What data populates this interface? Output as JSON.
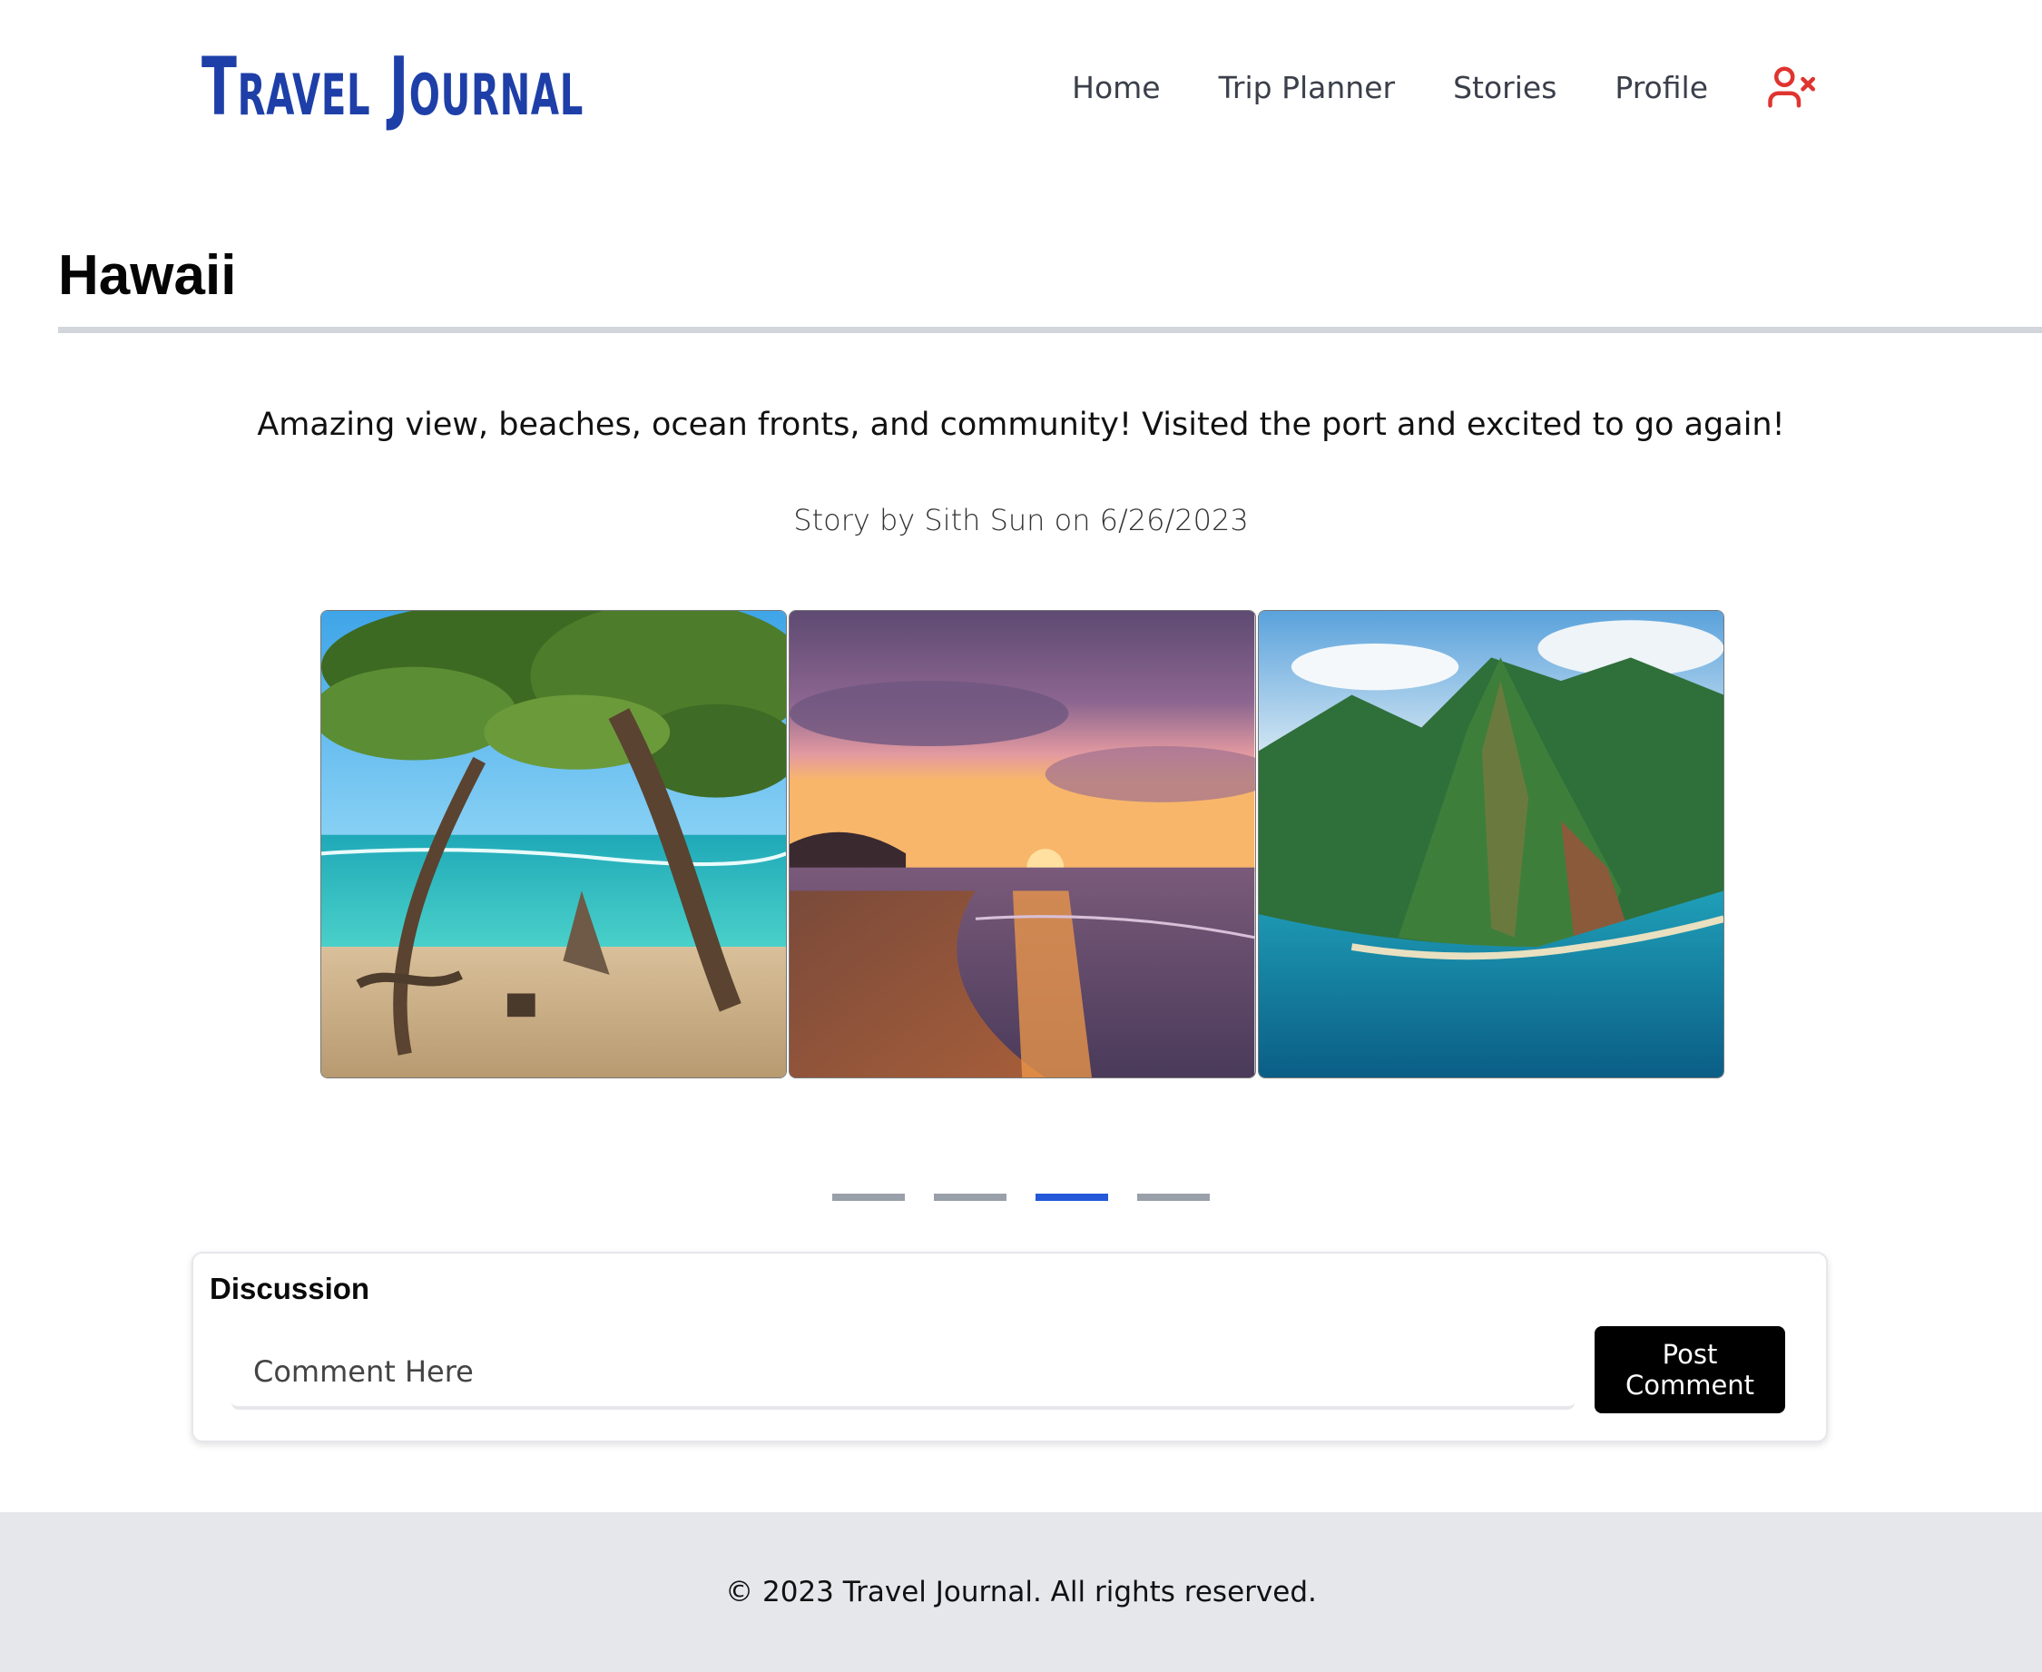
{
  "header": {
    "logo": "Travel Journal",
    "nav": [
      "Home",
      "Trip Planner",
      "Stories",
      "Profile"
    ],
    "logout_icon": "user-x-icon",
    "logout_icon_color": "#e0342f",
    "logo_color": "#1e3fa8"
  },
  "story": {
    "title": "Hawaii",
    "description": "Amazing view, beaches, ocean fronts, and community! Visited the port and excited to go again!",
    "byline": "Story by Sith Sun on 6/26/2023"
  },
  "carousel": {
    "slides": [
      "beach-tree-photo",
      "sunset-beach-photo",
      "mountain-coast-photo"
    ],
    "indicator_count": 4,
    "active_indicator": 3,
    "active_color": "#2458d8"
  },
  "discussion": {
    "heading": "Discussion",
    "placeholder": "Comment Here",
    "value": "",
    "post_label": "Post Comment"
  },
  "footer": {
    "text": "© 2023 Travel Journal. All rights reserved."
  }
}
